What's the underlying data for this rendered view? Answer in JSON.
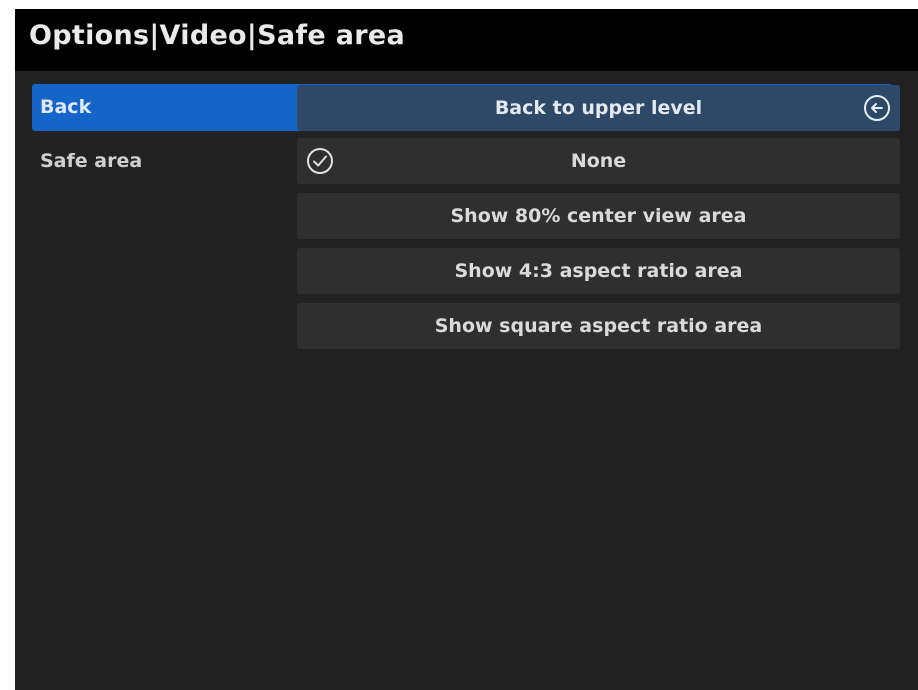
{
  "header": {
    "title": "Options|Video|Safe area"
  },
  "rows": [
    {
      "label": "Back",
      "options": [
        {
          "label": "Back to upper level",
          "icon": "back-arrow-icon"
        }
      ]
    },
    {
      "label": "Safe area",
      "options": [
        {
          "label": "None",
          "icon": "checkmark-icon",
          "checked": true
        },
        {
          "label": "Show 80% center view area"
        },
        {
          "label": "Show 4:3 aspect ratio area"
        },
        {
          "label": "Show square aspect ratio area"
        }
      ]
    }
  ],
  "colors": {
    "selected_row": "#1565c9",
    "highlighted_option": "#2e4967",
    "option_background": "#2f2f2f",
    "panel_background": "#222222",
    "titlebar_background": "#000000"
  }
}
